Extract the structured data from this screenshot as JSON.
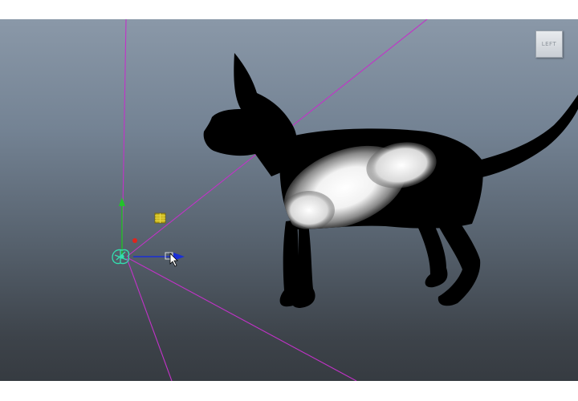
{
  "viewport": {
    "background_top": "#8a98a8",
    "background_bottom": "#363b41"
  },
  "view_cube": {
    "face_label": "LEFT"
  },
  "scene": {
    "camera_frustum_color": "#cc33cc",
    "cat_body_color": "#000000",
    "cat_patch_color": "#ffffff",
    "light_icon_color": "#d4c21a",
    "camera_icon_color": "#33e0b0"
  },
  "manipulator": {
    "tool": "move-tool",
    "axis_colors": {
      "x": "#1a2fd6",
      "y": "#22c42a",
      "z": "#e0241c"
    }
  },
  "cursor": {
    "icon": "arrow-pointer-icon"
  }
}
